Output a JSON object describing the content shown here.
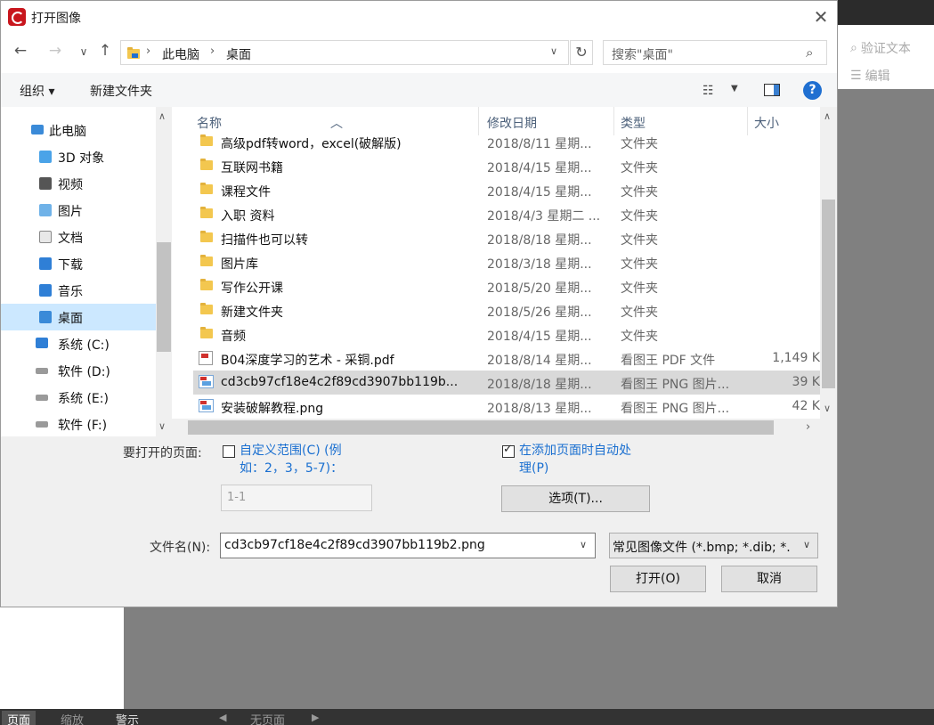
{
  "dialog": {
    "title": "打开图像",
    "close": "✕"
  },
  "nav": {
    "back": "←",
    "forward": "→",
    "history": "∨",
    "up": "↑",
    "crumb_sep": "›",
    "breadcrumb": [
      "此电脑",
      "桌面"
    ],
    "refresh": "↻",
    "search_placeholder": "搜索\"桌面\"",
    "search_icon": "⌕"
  },
  "toolbar": {
    "organize": "组织 ▾",
    "new_folder": "新建文件夹",
    "help": "?"
  },
  "sidebar": {
    "items": [
      {
        "label": "此电脑",
        "icon": "computer-icon"
      },
      {
        "label": "3D 对象",
        "icon": "3d-objects-icon"
      },
      {
        "label": "视频",
        "icon": "video-icon"
      },
      {
        "label": "图片",
        "icon": "pictures-icon"
      },
      {
        "label": "文档",
        "icon": "documents-icon"
      },
      {
        "label": "下载",
        "icon": "downloads-icon"
      },
      {
        "label": "音乐",
        "icon": "music-icon"
      },
      {
        "label": "桌面",
        "icon": "desktop-icon",
        "selected": true
      },
      {
        "label": "系统 (C:)",
        "icon": "windows-drive-icon"
      },
      {
        "label": "软件 (D:)",
        "icon": "drive-icon"
      },
      {
        "label": "系统 (E:)",
        "icon": "drive-icon"
      },
      {
        "label": "软件 (F:)",
        "icon": "drive-icon"
      }
    ]
  },
  "columns": {
    "name": "名称",
    "date": "修改日期",
    "type": "类型",
    "size": "大小"
  },
  "files": [
    {
      "name": "高级pdf转word，excel(破解版)",
      "date": "2018/8/11 星期...",
      "type": "文件夹",
      "size": "",
      "kind": "folder"
    },
    {
      "name": "互联网书籍",
      "date": "2018/4/15 星期...",
      "type": "文件夹",
      "size": "",
      "kind": "folder"
    },
    {
      "name": "课程文件",
      "date": "2018/4/15 星期...",
      "type": "文件夹",
      "size": "",
      "kind": "folder"
    },
    {
      "name": "入职 资料",
      "date": "2018/4/3 星期二 ...",
      "type": "文件夹",
      "size": "",
      "kind": "folder"
    },
    {
      "name": "扫描件也可以转",
      "date": "2018/8/18 星期...",
      "type": "文件夹",
      "size": "",
      "kind": "folder"
    },
    {
      "name": "图片库",
      "date": "2018/3/18 星期...",
      "type": "文件夹",
      "size": "",
      "kind": "folder"
    },
    {
      "name": "写作公开课",
      "date": "2018/5/20 星期...",
      "type": "文件夹",
      "size": "",
      "kind": "folder"
    },
    {
      "name": "新建文件夹",
      "date": "2018/5/26 星期...",
      "type": "文件夹",
      "size": "",
      "kind": "folder"
    },
    {
      "name": "音频",
      "date": "2018/4/15 星期...",
      "type": "文件夹",
      "size": "",
      "kind": "folder"
    },
    {
      "name": "B04深度学习的艺术 - 采铜.pdf",
      "date": "2018/8/14 星期...",
      "type": "看图王 PDF 文件",
      "size": "1,149 K",
      "kind": "pdf"
    },
    {
      "name": "cd3cb97cf18e4c2f89cd3907bb119b...",
      "date": "2018/8/18 星期...",
      "type": "看图王 PNG 图片...",
      "size": "39 K",
      "kind": "png",
      "selected": true
    },
    {
      "name": "安装破解教程.png",
      "date": "2018/8/13 星期...",
      "type": "看图王 PNG 图片...",
      "size": "42 K",
      "kind": "png"
    }
  ],
  "options": {
    "pages_label": "要打开的页面:",
    "custom_range_line1": "自定义范围(C) (例",
    "custom_range_line2": "如：2，3，5-7)：",
    "custom_range_checked": false,
    "range_value": "1-1",
    "auto_process_line1": "在添加页面时自动处",
    "auto_process_line2": "理(P)",
    "auto_process_checked": true,
    "options_button": "选项(T)..."
  },
  "footer": {
    "filename_label": "文件名(N):",
    "filename_value": "cd3cb97cf18e4c2f89cd3907bb119b2.png",
    "filter_value": "常见图像文件 (*.bmp; *.dib; *.",
    "open_button": "打开(O)",
    "cancel_button": "取消"
  },
  "background_app": {
    "verify_text": "验证文本",
    "edit": "编辑",
    "status_page": "页面",
    "status_zoom": "缩放",
    "status_alert": "警示",
    "status_prev": "◀",
    "status_nopage": "无页面",
    "status_next": "▶"
  },
  "colors": {
    "accent": "#1f6fd1",
    "selection": "#cce8ff",
    "row_selected": "#d9d9d9",
    "folder": "#f3c74f",
    "link": "#1a6fd0"
  }
}
